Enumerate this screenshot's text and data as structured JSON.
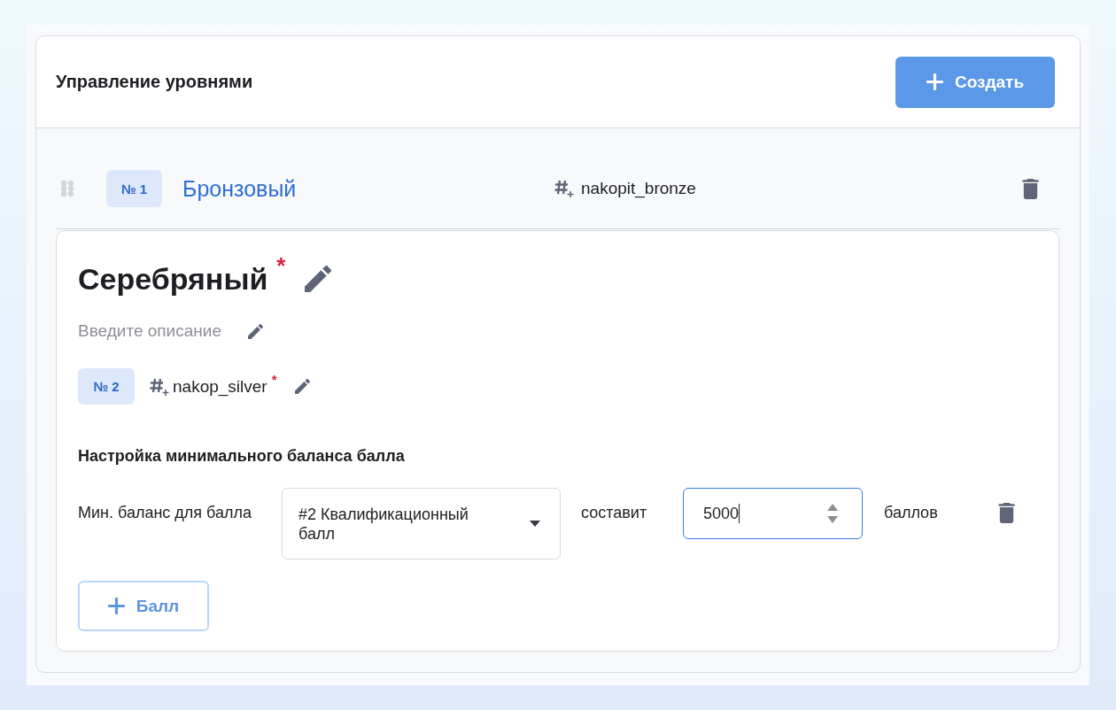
{
  "header": {
    "title": "Управление уровнями",
    "create_button": {
      "label": "Создать",
      "disabled": true
    }
  },
  "levels": [
    {
      "number": "№ 1",
      "name": "Бронзовый",
      "code": "nakopit_bronze",
      "expanded": false
    },
    {
      "number": "№ 2",
      "name": "Серебряный",
      "name_mark": "*",
      "code": "nakop_silver",
      "code_mark": "*",
      "expanded": true,
      "description": {
        "placeholder": "Введите описание"
      },
      "min_balance": {
        "title": "Настройка минимального баланса балла",
        "rows": [
          {
            "label": "Мин. баланс для балла",
            "point_select": {
              "value": "#2 Квалификационный балл"
            },
            "connector": "составит",
            "amount": {
              "value": "5000",
              "focused": true
            },
            "unit": "баллов"
          }
        ],
        "add_button": {
          "label": "Балл",
          "disabled": true
        }
      }
    }
  ]
}
